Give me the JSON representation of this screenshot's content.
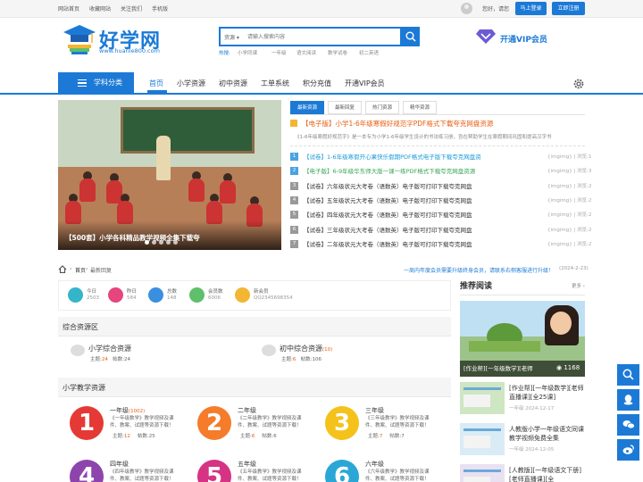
{
  "topbar": {
    "links": [
      "网站首页",
      "收藏网站",
      "关注我们",
      "手机版"
    ],
    "greeting": "您好，请您",
    "login": "马上登录",
    "register": "立即注册"
  },
  "logo": {
    "name": "好学网",
    "url": "www.huanle800.com"
  },
  "search": {
    "select": "资源",
    "placeholder": "请输入搜索内容",
    "hot_label": "热搜:",
    "hot": [
      "小学同课",
      "一年级",
      "语文阅读",
      "数学试卷",
      "初二英语"
    ]
  },
  "vip": "开通VIP会员",
  "nav": {
    "category": "学科分类",
    "items": [
      "首页",
      "小学资源",
      "初中资源",
      "工单系统",
      "积分充值",
      "开通VIP会员"
    ]
  },
  "slider": {
    "caption": "【500套】小学各科精品教学视频全集下载夸"
  },
  "news": {
    "tabs": [
      "最新资源",
      "最新回复",
      "热门资源",
      "精华资源"
    ],
    "headline": "【电子版】小学1-6年级寒假好规范字PDF格式下载夸克网盘资源",
    "summary": "《1-6年级寒假好规范字》是一本专为小学1-6年级学生设计的书法练习册，旨在帮助学生在寒假期间巩固和提高汉字书",
    "items": [
      {
        "num": "1",
        "title": "【试卷】1-6年级寒假开心果快乐假期PDF格式电子版下载夸克网盘资",
        "meta": "{imgimg} | 浏览:1",
        "color": "#1c9ad6",
        "num_bg": "#4aa3e0"
      },
      {
        "num": "2",
        "title": "【电子版】6-9年级华东师大版一课一练PDF格式下载夸克网盘资源",
        "meta": "{imgimg} | 浏览:3",
        "color": "#3aa55a",
        "num_bg": "#4aa3e0"
      },
      {
        "num": "3",
        "title": "【试卷】六年级状元大考卷（语数英）电子版可打印下载夸克网盘",
        "meta": "{imgimg} | 浏览:2",
        "color": "#333",
        "num_bg": "#999"
      },
      {
        "num": "4",
        "title": "【试卷】五年级状元大考卷（语数英）电子版可打印下载夸克网盘",
        "meta": "{imgimg} | 浏览:2",
        "color": "#333",
        "num_bg": "#999"
      },
      {
        "num": "5",
        "title": "【试卷】四年级状元大考卷（语数英）电子版可打印下载夸克网盘",
        "meta": "{imgimg} | 浏览:2",
        "color": "#333",
        "num_bg": "#999"
      },
      {
        "num": "6",
        "title": "【试卷】三年级状元大考卷（语数英）电子版可打印下载夸克网盘",
        "meta": "{imgimg} | 浏览:2",
        "color": "#333",
        "num_bg": "#999"
      },
      {
        "num": "7",
        "title": "【试卷】二年级状元大考卷（语数英）电子版可打印下载夸克网盘",
        "meta": "{imgimg} | 浏览:2",
        "color": "#333",
        "num_bg": "#999"
      }
    ]
  },
  "breadcrumb": {
    "home": "首页",
    "current": "最新回复"
  },
  "notice": {
    "text": "一周内年度会员需要升级终身会员，请联系右侧客服进行升级！",
    "date": "(2024-2-23)"
  },
  "stats": [
    {
      "label": "今日",
      "value": "2503",
      "color": "#35b5c9"
    },
    {
      "label": "昨日",
      "value": "584",
      "color": "#e6457d"
    },
    {
      "label": "总数",
      "value": "148",
      "color": "#3b8fe0"
    },
    {
      "label": "会员数",
      "value": "6006",
      "color": "#5fbf6a"
    },
    {
      "label": "新会员",
      "value": "QQ2345698354",
      "color": "#f2b632"
    }
  ],
  "section1": {
    "title": "综合资源区",
    "forums": [
      {
        "name": "小学综合资源",
        "badge": "",
        "topics_label": "主题:",
        "topics": "24",
        "posts_label": "帖数:",
        "posts": "24"
      },
      {
        "name": "初中综合资源",
        "badge": "(10)",
        "topics_label": "主题:",
        "topics": "6",
        "posts_label": "帖数:",
        "posts": "106"
      }
    ]
  },
  "section2": {
    "title": "小学教学资源",
    "grades": [
      {
        "n": "1",
        "name": "一年级",
        "badge": "(1002)",
        "desc": "《一年级数学》教学视频及课件、教案、试题等资源下载！",
        "topics": "12",
        "posts": "25",
        "color": "#e53935"
      },
      {
        "n": "2",
        "name": "二年级",
        "badge": "",
        "desc": "《二年级教学》教学视频及课件、教案、试题等资源下载！",
        "topics": "6",
        "posts": "6",
        "color": "#f47c2a"
      },
      {
        "n": "3",
        "name": "三年级",
        "badge": "",
        "desc": "《三年级教学》教学视频及课件、教案、试题等资源下载！",
        "topics": "7",
        "posts": "7",
        "color": "#f4c21a"
      },
      {
        "n": "4",
        "name": "四年级",
        "badge": "",
        "desc": "《四年级教学》教学视频及课件、教案、试题等资源下载！",
        "topics": "",
        "posts": "",
        "color": "#8e44ad"
      },
      {
        "n": "5",
        "name": "五年级",
        "badge": "",
        "desc": "《五年级教学》教学视频及课件、教案、试题等资源下载！",
        "topics": "",
        "posts": "",
        "color": "#d63384"
      },
      {
        "n": "6",
        "name": "六年级",
        "badge": "",
        "desc": "《六年级教学》教学视频及课件、教案、试题等资源下载！",
        "topics": "",
        "posts": "",
        "color": "#2aa7d6"
      }
    ],
    "topics_label": "主题:",
    "posts_label": "帖数:"
  },
  "recommend": {
    "title": "推荐阅读",
    "more": "更多",
    "feature_caption": "[作业帮][一年级数学][老师",
    "feature_views": "1168",
    "items": [
      {
        "title": "[作业帮][一年级数学][老师直播课][全25课]",
        "meta": "一年级   2024-12-17"
      },
      {
        "title": "人教版小学一年级语文同课教学视频免费全集",
        "meta": "一年级   2024-12-05"
      },
      {
        "title": "[人教版][一年级语文下册][老师直播课][全",
        "meta": ""
      }
    ]
  }
}
